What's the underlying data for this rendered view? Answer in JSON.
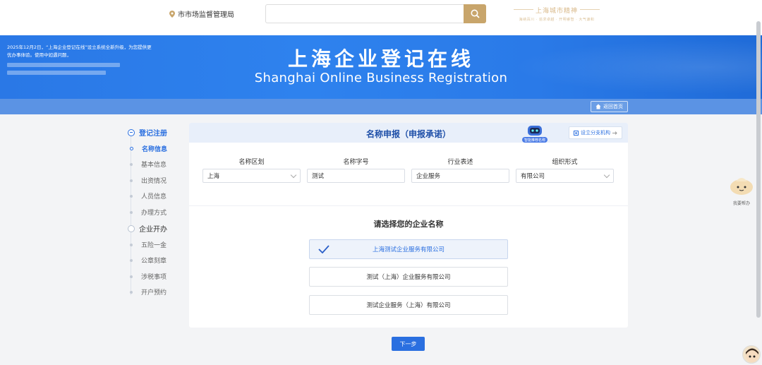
{
  "header": {
    "agency": "市市场监督管理局",
    "search_placeholder": "",
    "brand_title": "上海城市精神",
    "brand_sub": "海纳百川 · 追求卓越 · 开明睿智 · 大气谦和"
  },
  "banner": {
    "title": "上海企业登记在线",
    "subtitle": "Shanghai Online Business Registration",
    "notice": "2025年12月2日，“上海企业登记在线”设立系统全新升级，为您提供更优办事体验。使用中如遇问题，",
    "home_button": "返回首页"
  },
  "steps": {
    "groups": [
      {
        "label": "登记注册",
        "items": [
          "名称信息",
          "基本信息",
          "出资情况",
          "人员信息",
          "办理方式"
        ]
      },
      {
        "label": "企业开办",
        "items": [
          "五险一金",
          "公章刻章",
          "涉税事项",
          "开户预约"
        ]
      }
    ],
    "active_item": "名称信息"
  },
  "panel": {
    "title": "名称申报（申报承诺）",
    "robot_label": "智能推荐名称",
    "branch_button": "设立分支机构",
    "fields": [
      {
        "label": "名称区划",
        "value": "上海",
        "dropdown": true
      },
      {
        "label": "名称字号",
        "value": "测试",
        "dropdown": false
      },
      {
        "label": "行业表述",
        "value": "企业服务",
        "dropdown": false
      },
      {
        "label": "组织形式",
        "value": "有限公司",
        "dropdown": true
      }
    ],
    "choose_title": "请选择您的企业名称",
    "options": [
      "上海测试企业服务有限公司",
      "测试（上海）企业服务有限公司",
      "测试企业服务（上海）有限公司"
    ],
    "selected_option": 0,
    "next_button": "下一步"
  },
  "helper": {
    "label": "我要帮办"
  },
  "colors": {
    "primary": "#2a6fe0",
    "banner": "#2e82ee",
    "gold": "#c8a56b"
  }
}
